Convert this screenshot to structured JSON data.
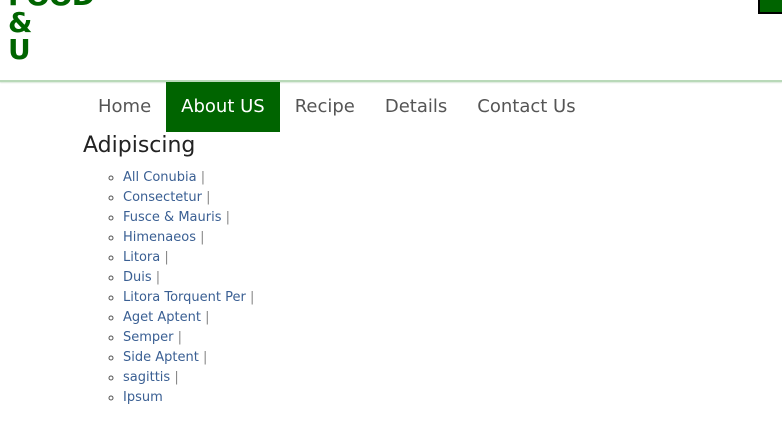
{
  "logo": {
    "line1": "FOOD",
    "line2": "&",
    "line3": "U"
  },
  "nav": {
    "items": [
      {
        "label": "Home",
        "active": false
      },
      {
        "label": "About US",
        "active": true
      },
      {
        "label": "Recipe",
        "active": false
      },
      {
        "label": "Details",
        "active": false
      },
      {
        "label": "Contact Us",
        "active": false
      }
    ]
  },
  "section": {
    "title": "Adipiscing",
    "separator": "|",
    "links": [
      "All Conubia",
      "Consectetur",
      "Fusce & Mauris",
      "Himenaeos",
      "Litora",
      "Duis",
      "Litora Torquent Per",
      "Aget Aptent",
      "Semper",
      "Side Aptent",
      "sagittis",
      "Ipsum"
    ]
  },
  "colors": {
    "brand_green": "#006400",
    "link": "#3a5f93",
    "nav_text": "#555555"
  }
}
